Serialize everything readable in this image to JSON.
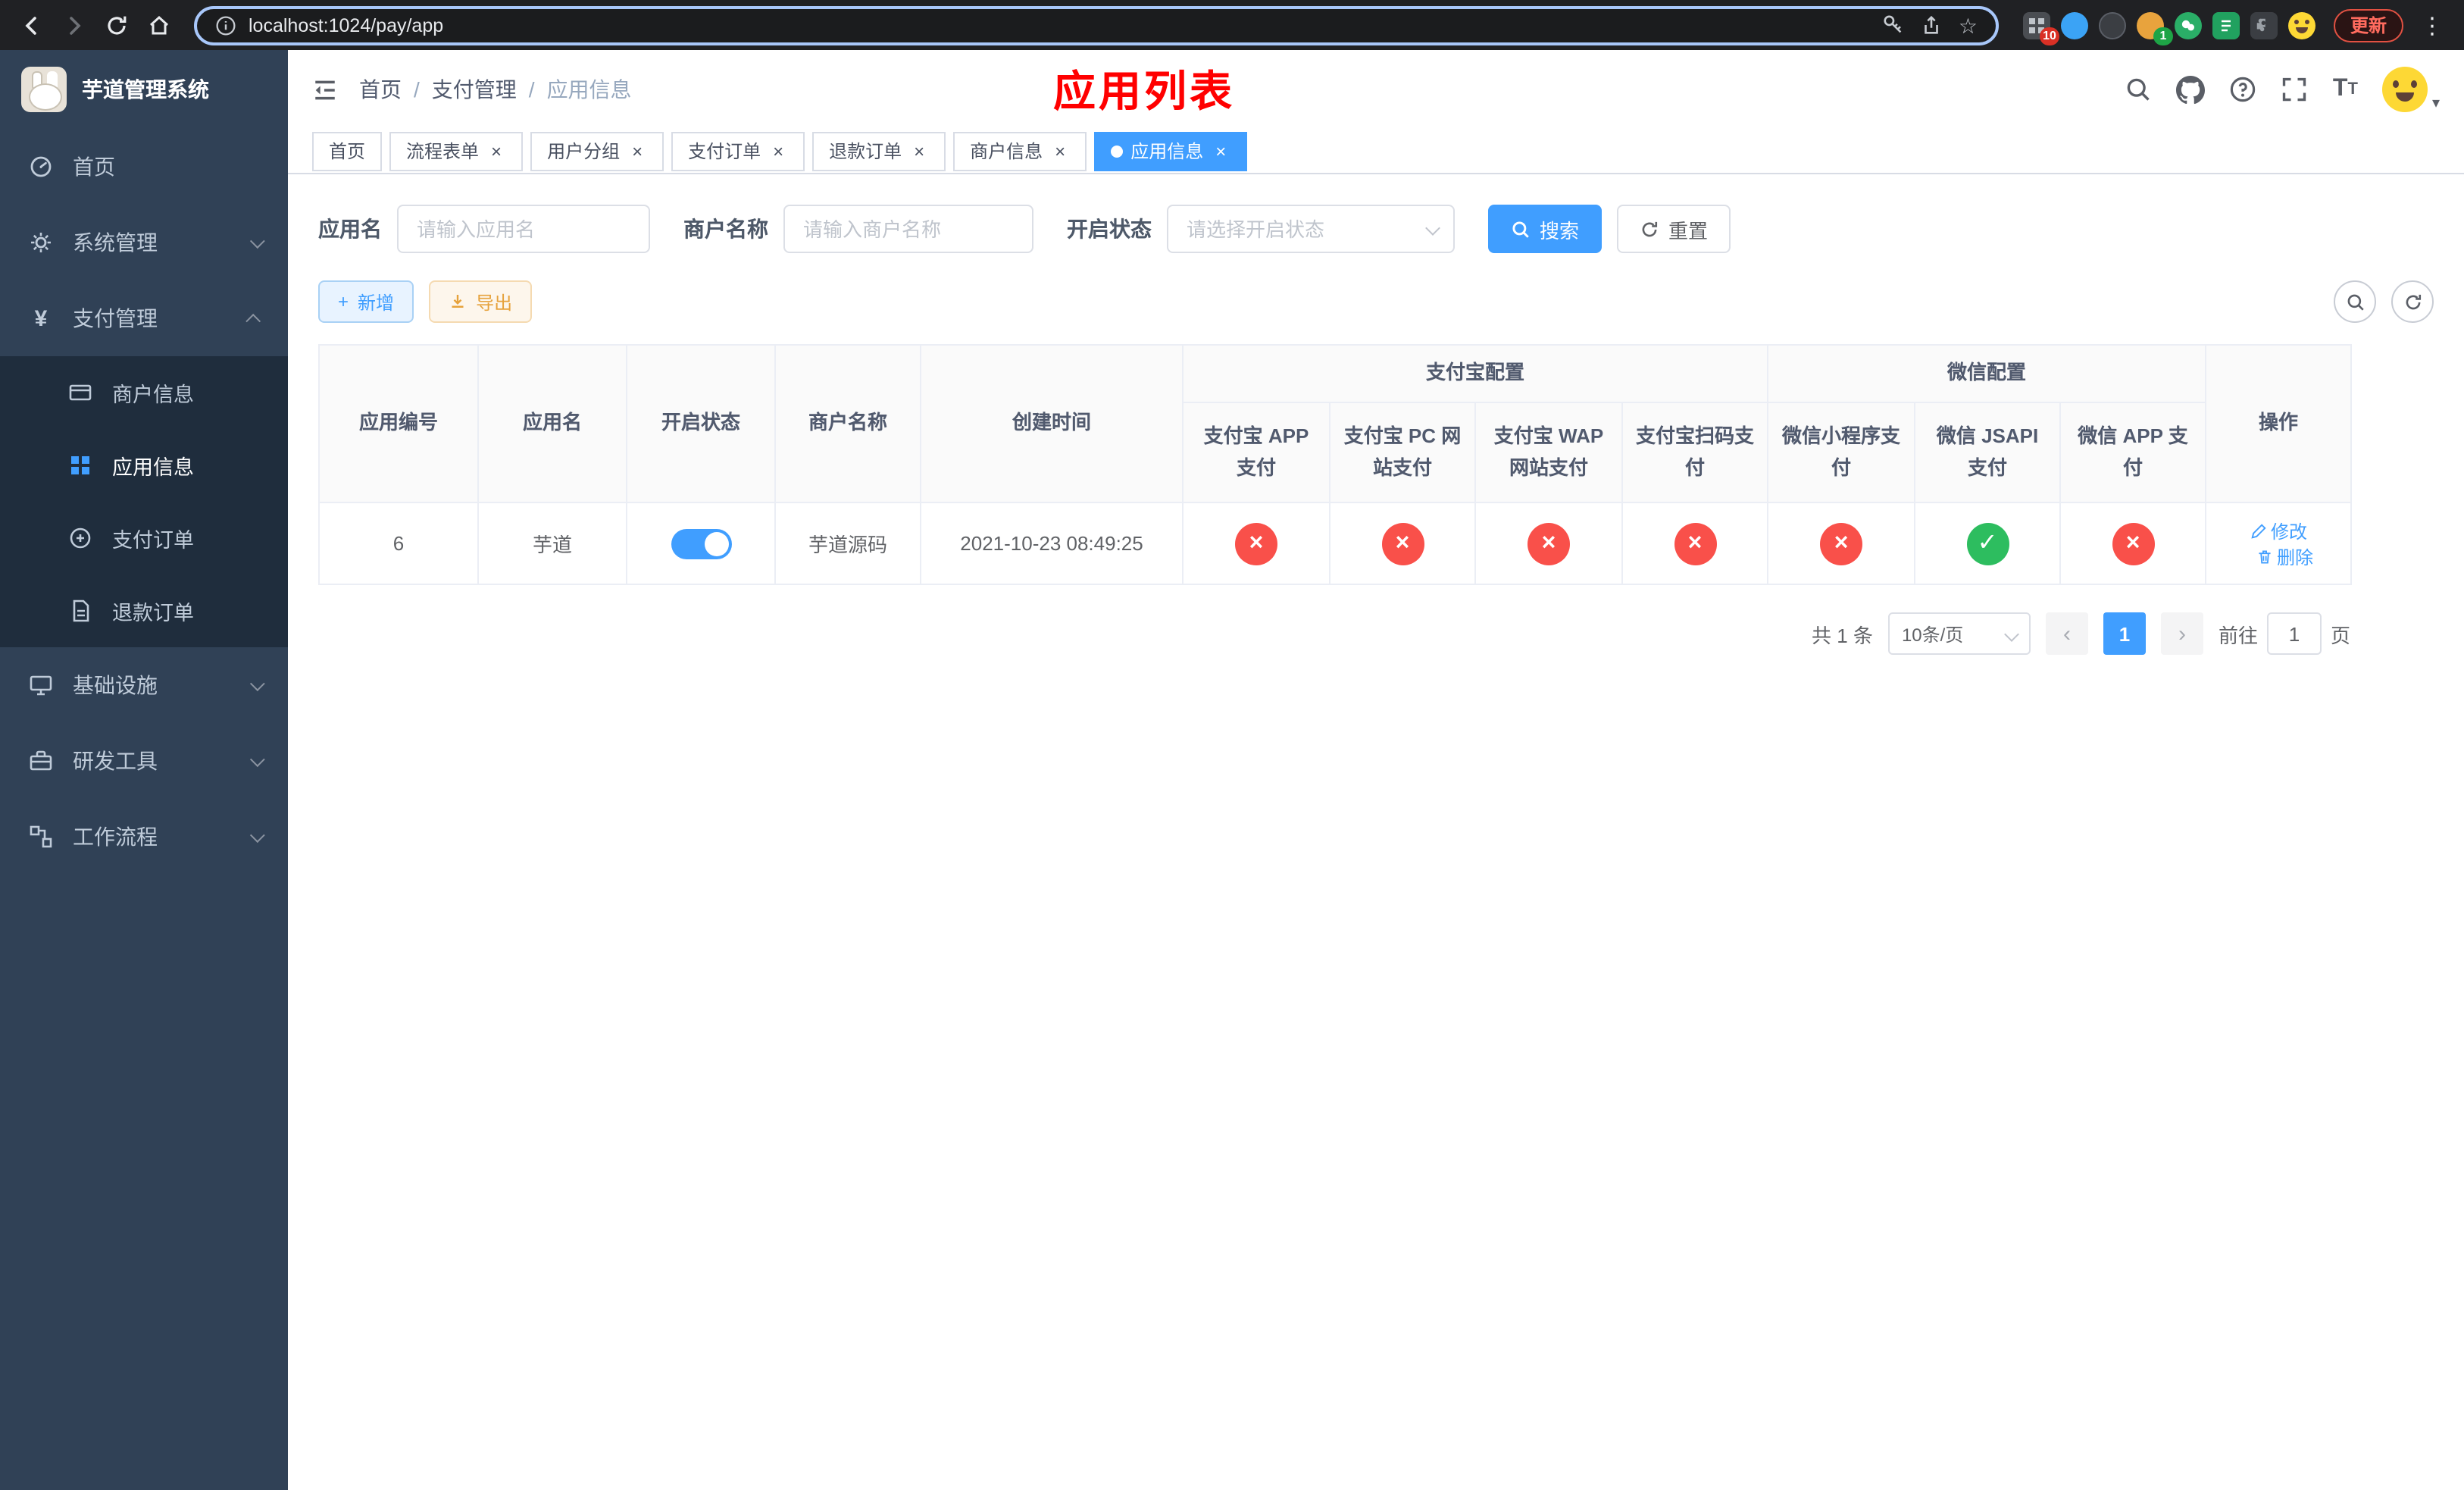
{
  "colors": {
    "accent": "#409eff",
    "success": "#2dbd5f",
    "danger": "#f9504a",
    "title_red": "#ff0000"
  },
  "icons": {
    "yen": "¥",
    "star": "☆",
    "kebab": "⋮",
    "caret": "▾",
    "plus": "+",
    "close": "×",
    "check": "✓",
    "cross": "×"
  },
  "browser": {
    "url": "localhost:1024/pay/app",
    "update_label": "更新",
    "extension_badge_grid": "10",
    "extension_badge_avatar": "1"
  },
  "sidebar": {
    "title": "芋道管理系统",
    "items": [
      {
        "label": "首页"
      },
      {
        "label": "系统管理"
      },
      {
        "label": "支付管理",
        "children": [
          {
            "label": "商户信息"
          },
          {
            "label": "应用信息"
          },
          {
            "label": "支付订单"
          },
          {
            "label": "退款订单"
          }
        ]
      },
      {
        "label": "基础设施"
      },
      {
        "label": "研发工具"
      },
      {
        "label": "工作流程"
      }
    ]
  },
  "header": {
    "breadcrumb": {
      "items": [
        "首页",
        "支付管理",
        "应用信息"
      ],
      "separator": "/"
    },
    "page_title": "应用列表"
  },
  "tabs": [
    {
      "label": "首页"
    },
    {
      "label": "流程表单"
    },
    {
      "label": "用户分组"
    },
    {
      "label": "支付订单"
    },
    {
      "label": "退款订单"
    },
    {
      "label": "商户信息"
    },
    {
      "label": "应用信息"
    }
  ],
  "filters": {
    "app_name": {
      "label": "应用名",
      "placeholder": "请输入应用名",
      "value": ""
    },
    "merchant_name": {
      "label": "商户名称",
      "placeholder": "请输入商户名称",
      "value": ""
    },
    "status": {
      "label": "开启状态",
      "placeholder": "请选择开启状态"
    },
    "search_label": "搜索",
    "reset_label": "重置"
  },
  "toolbar": {
    "add_label": "新增",
    "export_label": "导出"
  },
  "table": {
    "col_id": "应用编号",
    "col_name": "应用名",
    "col_status": "开启状态",
    "col_merchant": "商户名称",
    "col_created": "创建时间",
    "group_alipay": "支付宝配置",
    "group_wechat": "微信配置",
    "col_alipay_app": "支付宝 APP 支付",
    "col_alipay_pc": "支付宝 PC 网站支付",
    "col_alipay_wap": "支付宝 WAP 网站支付",
    "col_alipay_scan": "支付宝扫码支付",
    "col_wechat_mini": "微信小程序支付",
    "col_wechat_jsapi": "微信 JSAPI 支付",
    "col_wechat_app": "微信 APP 支付",
    "col_ops": "操作",
    "rows": [
      {
        "id": "6",
        "name": "芋道",
        "enabled": true,
        "merchant": "芋道源码",
        "created": "2021-10-23 08:49:25",
        "pay_status": [
          "no",
          "no",
          "no",
          "no",
          "no",
          "yes",
          "no"
        ],
        "edit_label": "修改",
        "delete_label": "删除"
      }
    ]
  },
  "pagination": {
    "total": "共 1 条",
    "page_size": "10条/页",
    "page": "1",
    "prev": "‹",
    "next": "›",
    "goto_prefix": "前往",
    "goto_value": "1",
    "goto_suffix": "页"
  }
}
